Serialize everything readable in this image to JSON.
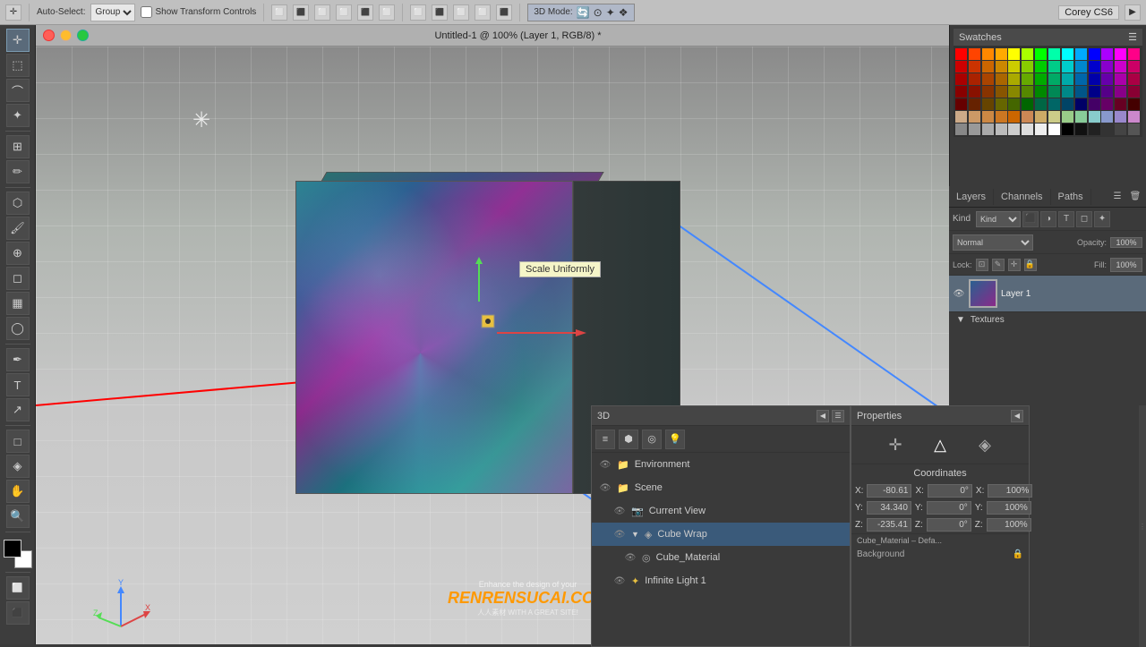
{
  "app": {
    "title": "Untitled-1 @ 100% (Layer 1, RGB/8) *",
    "user": "Corey CS6"
  },
  "toolbar": {
    "auto_select_label": "Auto-Select:",
    "group_option": "Group",
    "show_transform_label": "Show Transform Controls",
    "mode_label": "3D Mode:",
    "mode_options": [
      "3D Mode:"
    ]
  },
  "swatches": {
    "header": "Swatches",
    "colors": [
      "#ff0000",
      "#ff4400",
      "#ff8800",
      "#ffaa00",
      "#ffff00",
      "#aaff00",
      "#00ff00",
      "#00ffaa",
      "#00ffff",
      "#00aaff",
      "#0000ff",
      "#aa00ff",
      "#ff00ff",
      "#ff0088",
      "#cc0000",
      "#cc3300",
      "#cc6600",
      "#cc8800",
      "#cccc00",
      "#88cc00",
      "#00cc00",
      "#00cc88",
      "#00cccc",
      "#0088cc",
      "#0000cc",
      "#8800cc",
      "#cc00cc",
      "#cc0066",
      "#aa0000",
      "#aa2200",
      "#aa4400",
      "#aa6600",
      "#aaaa00",
      "#66aa00",
      "#00aa00",
      "#00aa66",
      "#00aaaa",
      "#0066aa",
      "#0000aa",
      "#6600aa",
      "#aa00aa",
      "#aa0044",
      "#880000",
      "#881100",
      "#883300",
      "#885500",
      "#888800",
      "#558800",
      "#008800",
      "#008855",
      "#008888",
      "#005588",
      "#000088",
      "#550088",
      "#880088",
      "#880033",
      "#660000",
      "#662200",
      "#664400",
      "#666600",
      "#446600",
      "#006600",
      "#006644",
      "#006666",
      "#004466",
      "#000066",
      "#440066",
      "#660066",
      "#660022",
      "#440000",
      "#ccaa88",
      "#cc9966",
      "#cc8844",
      "#cc7722",
      "#cc6600",
      "#cc8855",
      "#ccaa66",
      "#cccc88",
      "#99cc88",
      "#88cc99",
      "#88cccc",
      "#8899cc",
      "#9988cc",
      "#cc88cc",
      "#888888",
      "#999999",
      "#aaaaaa",
      "#bbbbbb",
      "#cccccc",
      "#dddddd",
      "#eeeeee",
      "#ffffff",
      "#000000",
      "#111111",
      "#222222",
      "#333333",
      "#444444",
      "#555555"
    ]
  },
  "layers_panel": {
    "tabs": [
      "Layers",
      "Channels",
      "Paths"
    ],
    "active_tab": "Layers",
    "blend_mode": "Normal",
    "opacity_label": "Opacity:",
    "opacity_value": "100%",
    "fill_label": "Fill:",
    "fill_value": "100%",
    "lock_label": "Lock:",
    "layer_name": "Layer 1",
    "textures_label": "Textures",
    "kind_label": "Kind",
    "icons": [
      "⊞",
      "▾",
      "⋯"
    ],
    "lock_icons": [
      "⊡",
      "✎",
      "✛",
      "🔒"
    ]
  },
  "scene_3d": {
    "panel_title": "3D",
    "items": [
      {
        "label": "Environment",
        "type": "folder",
        "level": 0
      },
      {
        "label": "Scene",
        "type": "folder",
        "level": 0
      },
      {
        "label": "Current View",
        "type": "view",
        "level": 1
      },
      {
        "label": "Cube Wrap",
        "type": "mesh",
        "level": 1,
        "highlighted": true
      },
      {
        "label": "Cube_Material",
        "type": "material",
        "level": 2
      },
      {
        "label": "Infinite Light 1",
        "type": "light",
        "level": 1
      }
    ]
  },
  "properties": {
    "panel_title": "Properties",
    "coords_title": "Coordinates",
    "x_pos": "-80.61",
    "y_pos": "34.340",
    "z_pos": "-235.41",
    "x_rot": "0°",
    "y_rot": "0°",
    "z_rot": "0°",
    "x_scale": "100%",
    "y_scale": "100%",
    "z_scale": "100%",
    "material_label": "Cube_Material – Defa...",
    "bg_label": "Background"
  },
  "canvas": {
    "tooltip": "Scale Uniformly"
  },
  "axis_widget": {
    "x_label": "X",
    "y_label": "Y",
    "z_label": "Z"
  }
}
